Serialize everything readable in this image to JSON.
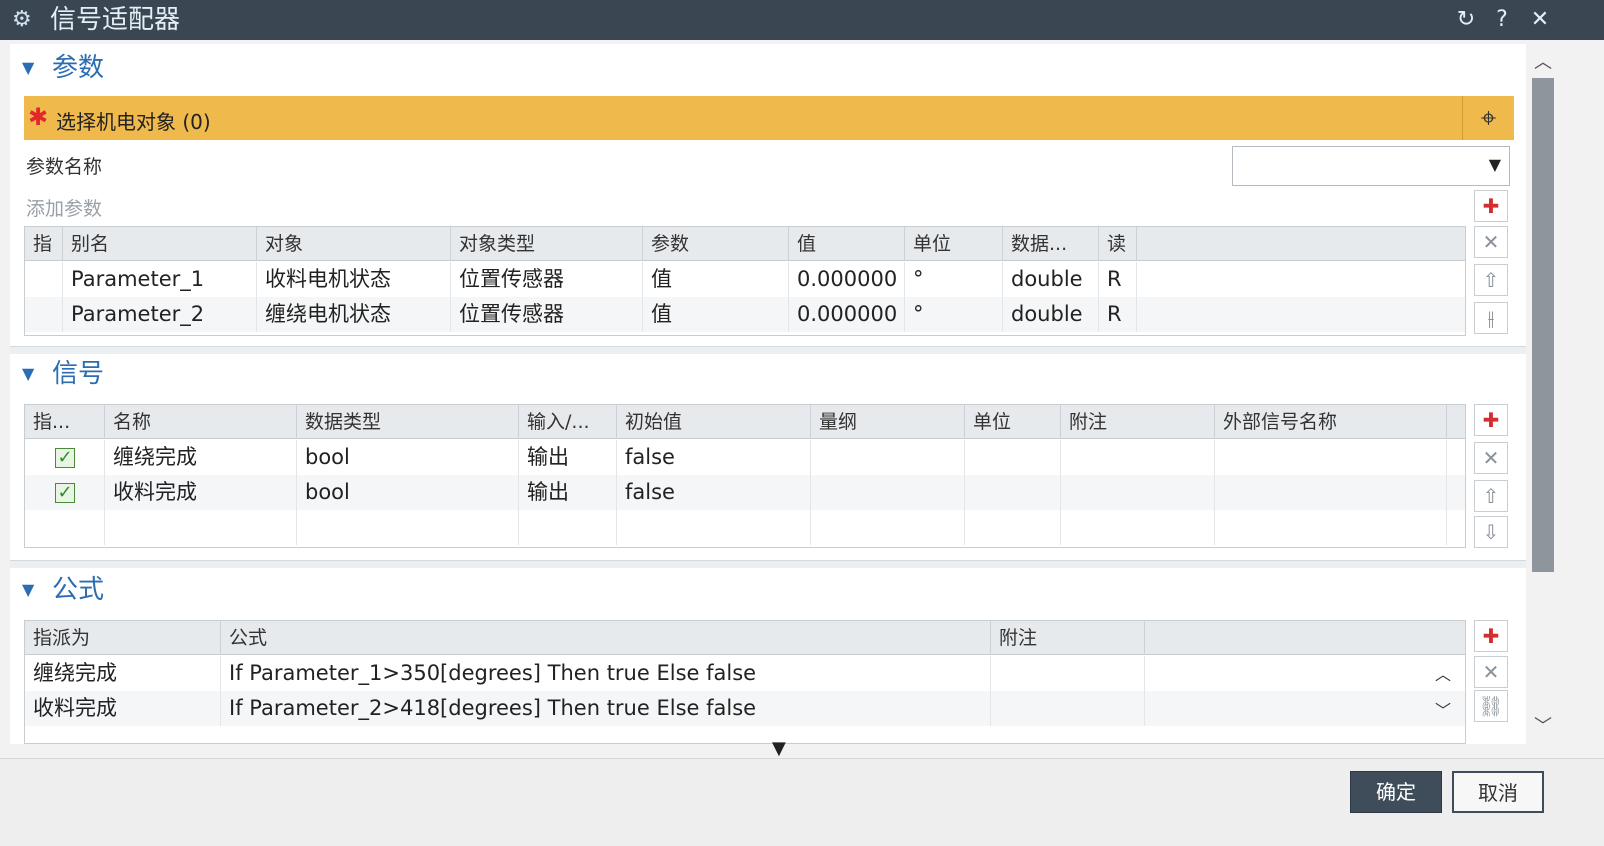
{
  "window": {
    "title": "信号适配器",
    "icons": {
      "app": "gear-icon",
      "reset": "reset-icon",
      "help": "help-icon",
      "close": "close-icon"
    }
  },
  "parameters_section": {
    "title": "参数",
    "select_object": {
      "label": "选择机电对象 (0)",
      "icon": "crosshair-icon"
    },
    "param_name_label": "参数名称",
    "param_name_value": "",
    "add_param_label": "添加参数",
    "table": {
      "columns": [
        "指",
        "别名",
        "对象",
        "对象类型",
        "参数",
        "值",
        "单位",
        "数据...",
        "读"
      ],
      "rows": [
        {
          "index": "",
          "alias": "Parameter_1",
          "object": "收料电机状态",
          "object_type": "位置传感器",
          "param": "值",
          "value": "0.000000",
          "unit": "°",
          "data_type": "double",
          "rw": "R"
        },
        {
          "index": "",
          "alias": "Parameter_2",
          "object": "缠绕电机状态",
          "object_type": "位置传感器",
          "param": "值",
          "value": "0.000000",
          "unit": "°",
          "data_type": "double",
          "rw": "R"
        }
      ]
    },
    "side_buttons": [
      "add-icon",
      "delete-icon",
      "move-up-icon",
      "split-icon"
    ]
  },
  "signals_section": {
    "title": "信号",
    "table": {
      "columns": [
        "指...",
        "名称",
        "数据类型",
        "输入/...",
        "初始值",
        "量纲",
        "单位",
        "附注",
        "外部信号名称"
      ],
      "rows": [
        {
          "checked": true,
          "name": "缠绕完成",
          "data_type": "bool",
          "io": "输出",
          "initial": "false",
          "dimension": "",
          "unit": "",
          "note": "",
          "external": ""
        },
        {
          "checked": true,
          "name": "收料完成",
          "data_type": "bool",
          "io": "输出",
          "initial": "false",
          "dimension": "",
          "unit": "",
          "note": "",
          "external": ""
        }
      ]
    },
    "side_buttons": [
      "add-icon",
      "delete-icon",
      "move-up-icon",
      "move-down-icon"
    ]
  },
  "formula_section": {
    "title": "公式",
    "table": {
      "columns": [
        "指派为",
        "公式",
        "附注"
      ],
      "rows": [
        {
          "assign": "缠绕完成",
          "formula": "If Parameter_1>350[degrees] Then true Else false",
          "note": ""
        },
        {
          "assign": "收料完成",
          "formula": "If Parameter_2>418[degrees] Then true Else false",
          "note": ""
        }
      ]
    },
    "side_buttons": [
      "add-icon",
      "delete-icon",
      "link-icon"
    ]
  },
  "footer": {
    "ok_label": "确定",
    "cancel_label": "取消"
  }
}
